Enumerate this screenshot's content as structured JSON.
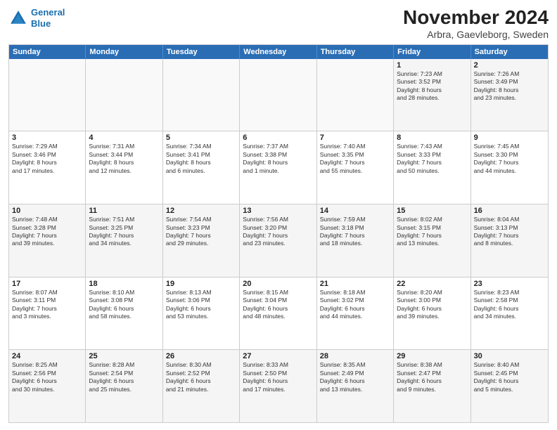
{
  "logo": {
    "line1": "General",
    "line2": "Blue"
  },
  "title": "November 2024",
  "subtitle": "Arbra, Gaevleborg, Sweden",
  "header_days": [
    "Sunday",
    "Monday",
    "Tuesday",
    "Wednesday",
    "Thursday",
    "Friday",
    "Saturday"
  ],
  "rows": [
    [
      {
        "day": "",
        "info": "",
        "empty": true
      },
      {
        "day": "",
        "info": "",
        "empty": true
      },
      {
        "day": "",
        "info": "",
        "empty": true
      },
      {
        "day": "",
        "info": "",
        "empty": true
      },
      {
        "day": "",
        "info": "",
        "empty": true
      },
      {
        "day": "1",
        "info": "Sunrise: 7:23 AM\nSunset: 3:52 PM\nDaylight: 8 hours\nand 28 minutes."
      },
      {
        "day": "2",
        "info": "Sunrise: 7:26 AM\nSunset: 3:49 PM\nDaylight: 8 hours\nand 23 minutes."
      }
    ],
    [
      {
        "day": "3",
        "info": "Sunrise: 7:29 AM\nSunset: 3:46 PM\nDaylight: 8 hours\nand 17 minutes."
      },
      {
        "day": "4",
        "info": "Sunrise: 7:31 AM\nSunset: 3:44 PM\nDaylight: 8 hours\nand 12 minutes."
      },
      {
        "day": "5",
        "info": "Sunrise: 7:34 AM\nSunset: 3:41 PM\nDaylight: 8 hours\nand 6 minutes."
      },
      {
        "day": "6",
        "info": "Sunrise: 7:37 AM\nSunset: 3:38 PM\nDaylight: 8 hours\nand 1 minute."
      },
      {
        "day": "7",
        "info": "Sunrise: 7:40 AM\nSunset: 3:35 PM\nDaylight: 7 hours\nand 55 minutes."
      },
      {
        "day": "8",
        "info": "Sunrise: 7:43 AM\nSunset: 3:33 PM\nDaylight: 7 hours\nand 50 minutes."
      },
      {
        "day": "9",
        "info": "Sunrise: 7:45 AM\nSunset: 3:30 PM\nDaylight: 7 hours\nand 44 minutes."
      }
    ],
    [
      {
        "day": "10",
        "info": "Sunrise: 7:48 AM\nSunset: 3:28 PM\nDaylight: 7 hours\nand 39 minutes."
      },
      {
        "day": "11",
        "info": "Sunrise: 7:51 AM\nSunset: 3:25 PM\nDaylight: 7 hours\nand 34 minutes."
      },
      {
        "day": "12",
        "info": "Sunrise: 7:54 AM\nSunset: 3:23 PM\nDaylight: 7 hours\nand 29 minutes."
      },
      {
        "day": "13",
        "info": "Sunrise: 7:56 AM\nSunset: 3:20 PM\nDaylight: 7 hours\nand 23 minutes."
      },
      {
        "day": "14",
        "info": "Sunrise: 7:59 AM\nSunset: 3:18 PM\nDaylight: 7 hours\nand 18 minutes."
      },
      {
        "day": "15",
        "info": "Sunrise: 8:02 AM\nSunset: 3:15 PM\nDaylight: 7 hours\nand 13 minutes."
      },
      {
        "day": "16",
        "info": "Sunrise: 8:04 AM\nSunset: 3:13 PM\nDaylight: 7 hours\nand 8 minutes."
      }
    ],
    [
      {
        "day": "17",
        "info": "Sunrise: 8:07 AM\nSunset: 3:11 PM\nDaylight: 7 hours\nand 3 minutes."
      },
      {
        "day": "18",
        "info": "Sunrise: 8:10 AM\nSunset: 3:08 PM\nDaylight: 6 hours\nand 58 minutes."
      },
      {
        "day": "19",
        "info": "Sunrise: 8:13 AM\nSunset: 3:06 PM\nDaylight: 6 hours\nand 53 minutes."
      },
      {
        "day": "20",
        "info": "Sunrise: 8:15 AM\nSunset: 3:04 PM\nDaylight: 6 hours\nand 48 minutes."
      },
      {
        "day": "21",
        "info": "Sunrise: 8:18 AM\nSunset: 3:02 PM\nDaylight: 6 hours\nand 44 minutes."
      },
      {
        "day": "22",
        "info": "Sunrise: 8:20 AM\nSunset: 3:00 PM\nDaylight: 6 hours\nand 39 minutes."
      },
      {
        "day": "23",
        "info": "Sunrise: 8:23 AM\nSunset: 2:58 PM\nDaylight: 6 hours\nand 34 minutes."
      }
    ],
    [
      {
        "day": "24",
        "info": "Sunrise: 8:25 AM\nSunset: 2:56 PM\nDaylight: 6 hours\nand 30 minutes."
      },
      {
        "day": "25",
        "info": "Sunrise: 8:28 AM\nSunset: 2:54 PM\nDaylight: 6 hours\nand 25 minutes."
      },
      {
        "day": "26",
        "info": "Sunrise: 8:30 AM\nSunset: 2:52 PM\nDaylight: 6 hours\nand 21 minutes."
      },
      {
        "day": "27",
        "info": "Sunrise: 8:33 AM\nSunset: 2:50 PM\nDaylight: 6 hours\nand 17 minutes."
      },
      {
        "day": "28",
        "info": "Sunrise: 8:35 AM\nSunset: 2:49 PM\nDaylight: 6 hours\nand 13 minutes."
      },
      {
        "day": "29",
        "info": "Sunrise: 8:38 AM\nSunset: 2:47 PM\nDaylight: 6 hours\nand 9 minutes."
      },
      {
        "day": "30",
        "info": "Sunrise: 8:40 AM\nSunset: 2:45 PM\nDaylight: 6 hours\nand 5 minutes."
      }
    ]
  ]
}
